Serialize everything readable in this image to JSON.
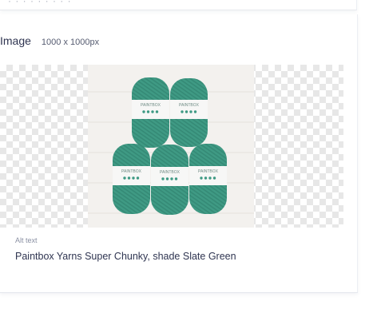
{
  "top_card": {
    "clipped_text": "· · · · · · · · ·"
  },
  "image_field": {
    "title": "Image",
    "dimensions": "1000 x 1000px",
    "preview": {
      "background": "transparency-checkerboard",
      "yarn_color": "#3e9a84",
      "skein_labels": [
        "PAINTBOX",
        "PAINTBOX",
        "PAINTBOX",
        "PAINTBOX",
        "PAINTBOX"
      ]
    },
    "alt_label": "Alt text",
    "alt_value": "Paintbox Yarns Super Chunky, shade Slate Green"
  }
}
